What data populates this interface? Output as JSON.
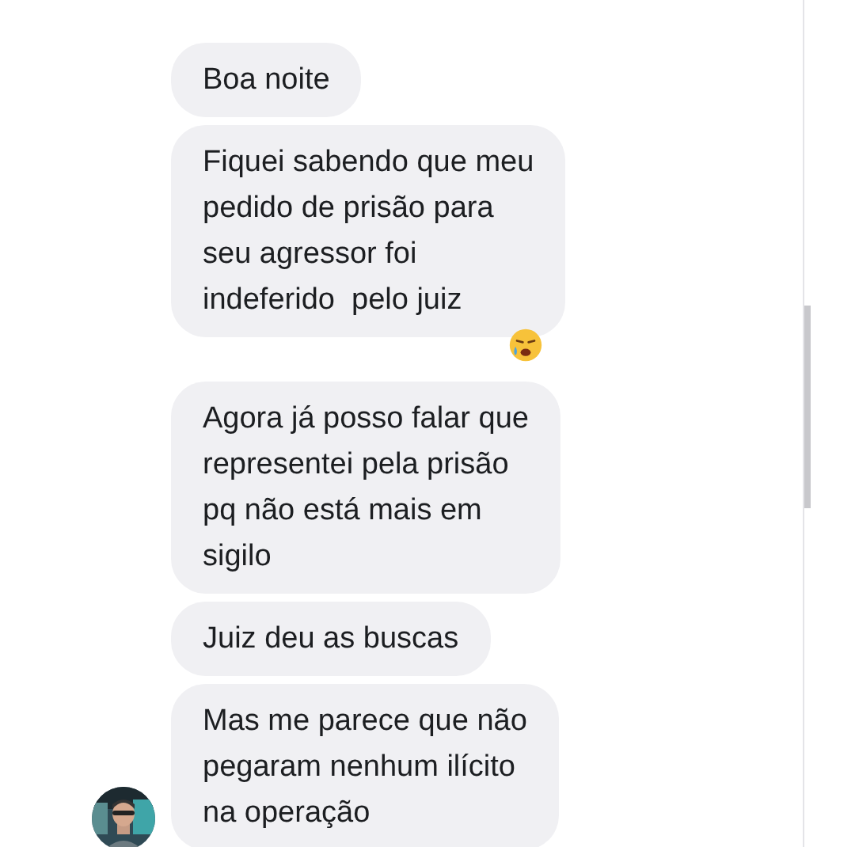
{
  "messages": [
    {
      "text": "Boa noite",
      "reacted": false,
      "avatar": false
    },
    {
      "text": "Fiquei sabendo que meu\npedido de prisão para\nseu agressor foi\nindeferido  pelo juiz",
      "reacted": true,
      "avatar": false
    },
    {
      "text": "Agora já posso falar que\nrepresentei pela prisão\npq não está mais em\nsigilo",
      "reacted": false,
      "avatar": false
    },
    {
      "text": "Juiz deu as buscas",
      "reacted": false,
      "avatar": false
    },
    {
      "text": "Mas me parece que não\npegaram nenhum ilícito\nna operação",
      "reacted": false,
      "avatar": true
    }
  ]
}
